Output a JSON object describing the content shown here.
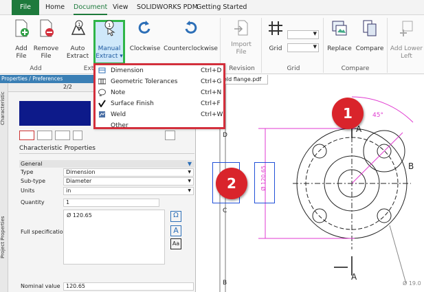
{
  "tabs": [
    "File",
    "Home",
    "Document",
    "View",
    "SOLIDWORKS PDM",
    "Getting Started"
  ],
  "ribbon": {
    "buttons": [
      {
        "l1": "Add",
        "l2": "File"
      },
      {
        "l1": "Remove",
        "l2": "File"
      },
      {
        "l1": "Auto",
        "l2": "Extract"
      },
      {
        "l1": "Manual",
        "l2": "Extract ▾"
      },
      {
        "l1": "Clockwise",
        "l2": ""
      },
      {
        "l1": "Counterclockwise",
        "l2": ""
      },
      {
        "l1": "Import",
        "l2": "File"
      },
      {
        "l1": "Grid",
        "l2": ""
      },
      {
        "l1": "Replace",
        "l2": ""
      },
      {
        "l1": "Compare",
        "l2": ""
      },
      {
        "l1": "Add Lower",
        "l2": "Left"
      }
    ],
    "groups": [
      "Add",
      "Ext",
      "Revision",
      "Grid",
      "Compare"
    ]
  },
  "menu": {
    "items": [
      {
        "label": "Dimension",
        "key": "Ctrl+D"
      },
      {
        "label": "Geometric Tolerances",
        "key": "Ctrl+G"
      },
      {
        "label": "Note",
        "key": "Ctrl+N"
      },
      {
        "label": "Surface Finish",
        "key": "Ctrl+F"
      },
      {
        "label": "Weld",
        "key": "Ctrl+W"
      },
      {
        "label": "Other",
        "key": ""
      }
    ]
  },
  "pane": {
    "title": "Properties / Preferences",
    "page": "2/2",
    "vtabs": [
      "Characteristic",
      "Project Properties"
    ],
    "section": "Characteristic Properties",
    "general": "General",
    "rows": [
      {
        "label": "Type",
        "value": "Dimension"
      },
      {
        "label": "Sub-type",
        "value": "Diameter"
      },
      {
        "label": "Units",
        "value": "in"
      },
      {
        "label": "Quantity",
        "value": "1"
      }
    ],
    "fullspec_label": "Full specification",
    "fullspec_value": "Ø 120.65",
    "nominal_label": "Nominal value",
    "nominal_value": "120.65",
    "omega": "Ω",
    "fontA": "A",
    "fontAa": "Aa"
  },
  "doc": {
    "file_tab": "eld flange.pdf",
    "zoneD": "D",
    "zoneC": "C",
    "zoneB": "B",
    "dim_vertical": "Ø 120.65",
    "angle": "45°",
    "labelA1": "A",
    "labelA2": "A",
    "labelB": "B",
    "dim_bottom": "Ø 19.0"
  },
  "badges": [
    "1",
    "2"
  ],
  "colors": {
    "green": "#1e7a3c",
    "red": "#d32f3c",
    "badge": "#d9242b",
    "magenta": "#e03ad0",
    "blue": "#1f4fd8",
    "navy": "#0d1a8a"
  }
}
